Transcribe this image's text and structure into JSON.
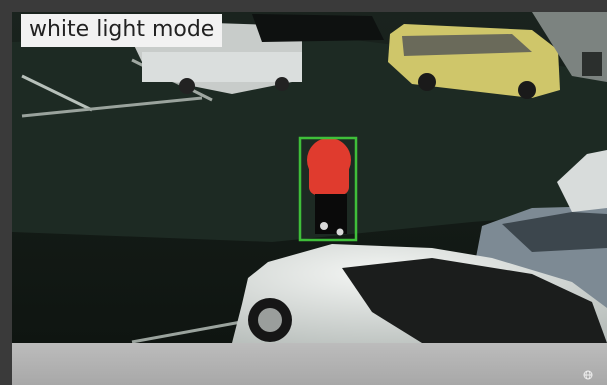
{
  "camera_view": {
    "mode_label": "white light mode",
    "detection_box_color": "#3fbf3a"
  },
  "bottom_bar": {
    "icon": "globe-icon"
  }
}
